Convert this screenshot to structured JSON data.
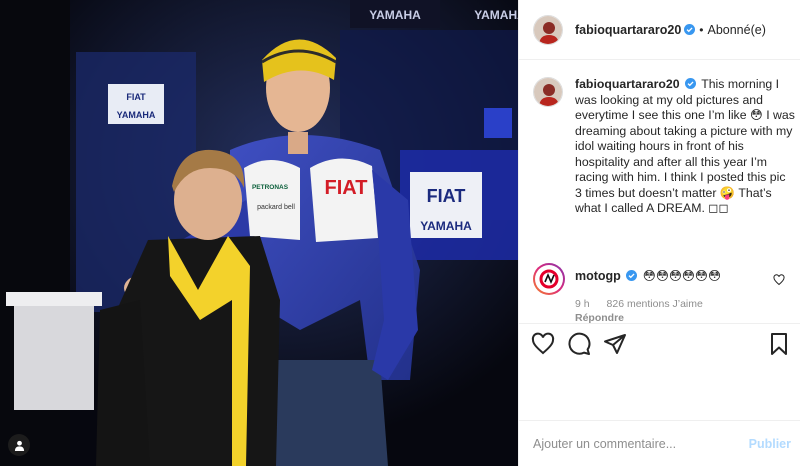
{
  "colors": {
    "accent": "#0095f6",
    "publish_disabled": "#b3dbff",
    "verified": "#3897f0",
    "muted": "#8e8e8e"
  },
  "header": {
    "username": "fabioquartararo20",
    "separator": "•",
    "follow_status": "Abonné(e)"
  },
  "photo": {
    "signage": {
      "yamaha_top_1": "YAMAHA",
      "yamaha_top_2": "YAMAHA",
      "fiat_left": "FIAT",
      "yamaha_left": "YAMAHA",
      "fiat_right": "FIAT",
      "yamaha_right": "YAMAHA",
      "fiat_jacket": "FIAT",
      "petronas": "PETRONAS",
      "packard": "packard bell"
    }
  },
  "caption": {
    "username": "fabioquartararo20",
    "text": "This morning I was looking at my old pictures and everytime I see this one I’m like 😳 I was dreaming about taking a picture with my idol waiting hours in front of his hospitality and after all this year I’m racing with him. I think I posted this pic 3 times but doesn’t matter 🤪 That’s what I called A DREAM. ◻◻"
  },
  "comment": {
    "username": "motogp",
    "text": "😳😳😳😳😳😳",
    "time": "9 h",
    "likes": "826 mentions J’aime",
    "reply": "Répondre"
  },
  "add_comment": {
    "placeholder": "Ajouter un commentaire...",
    "publish": "Publier"
  },
  "icons": [
    "user-tag-icon",
    "verified-badge-icon",
    "heart-icon",
    "comment-icon",
    "share-icon",
    "bookmark-icon"
  ]
}
